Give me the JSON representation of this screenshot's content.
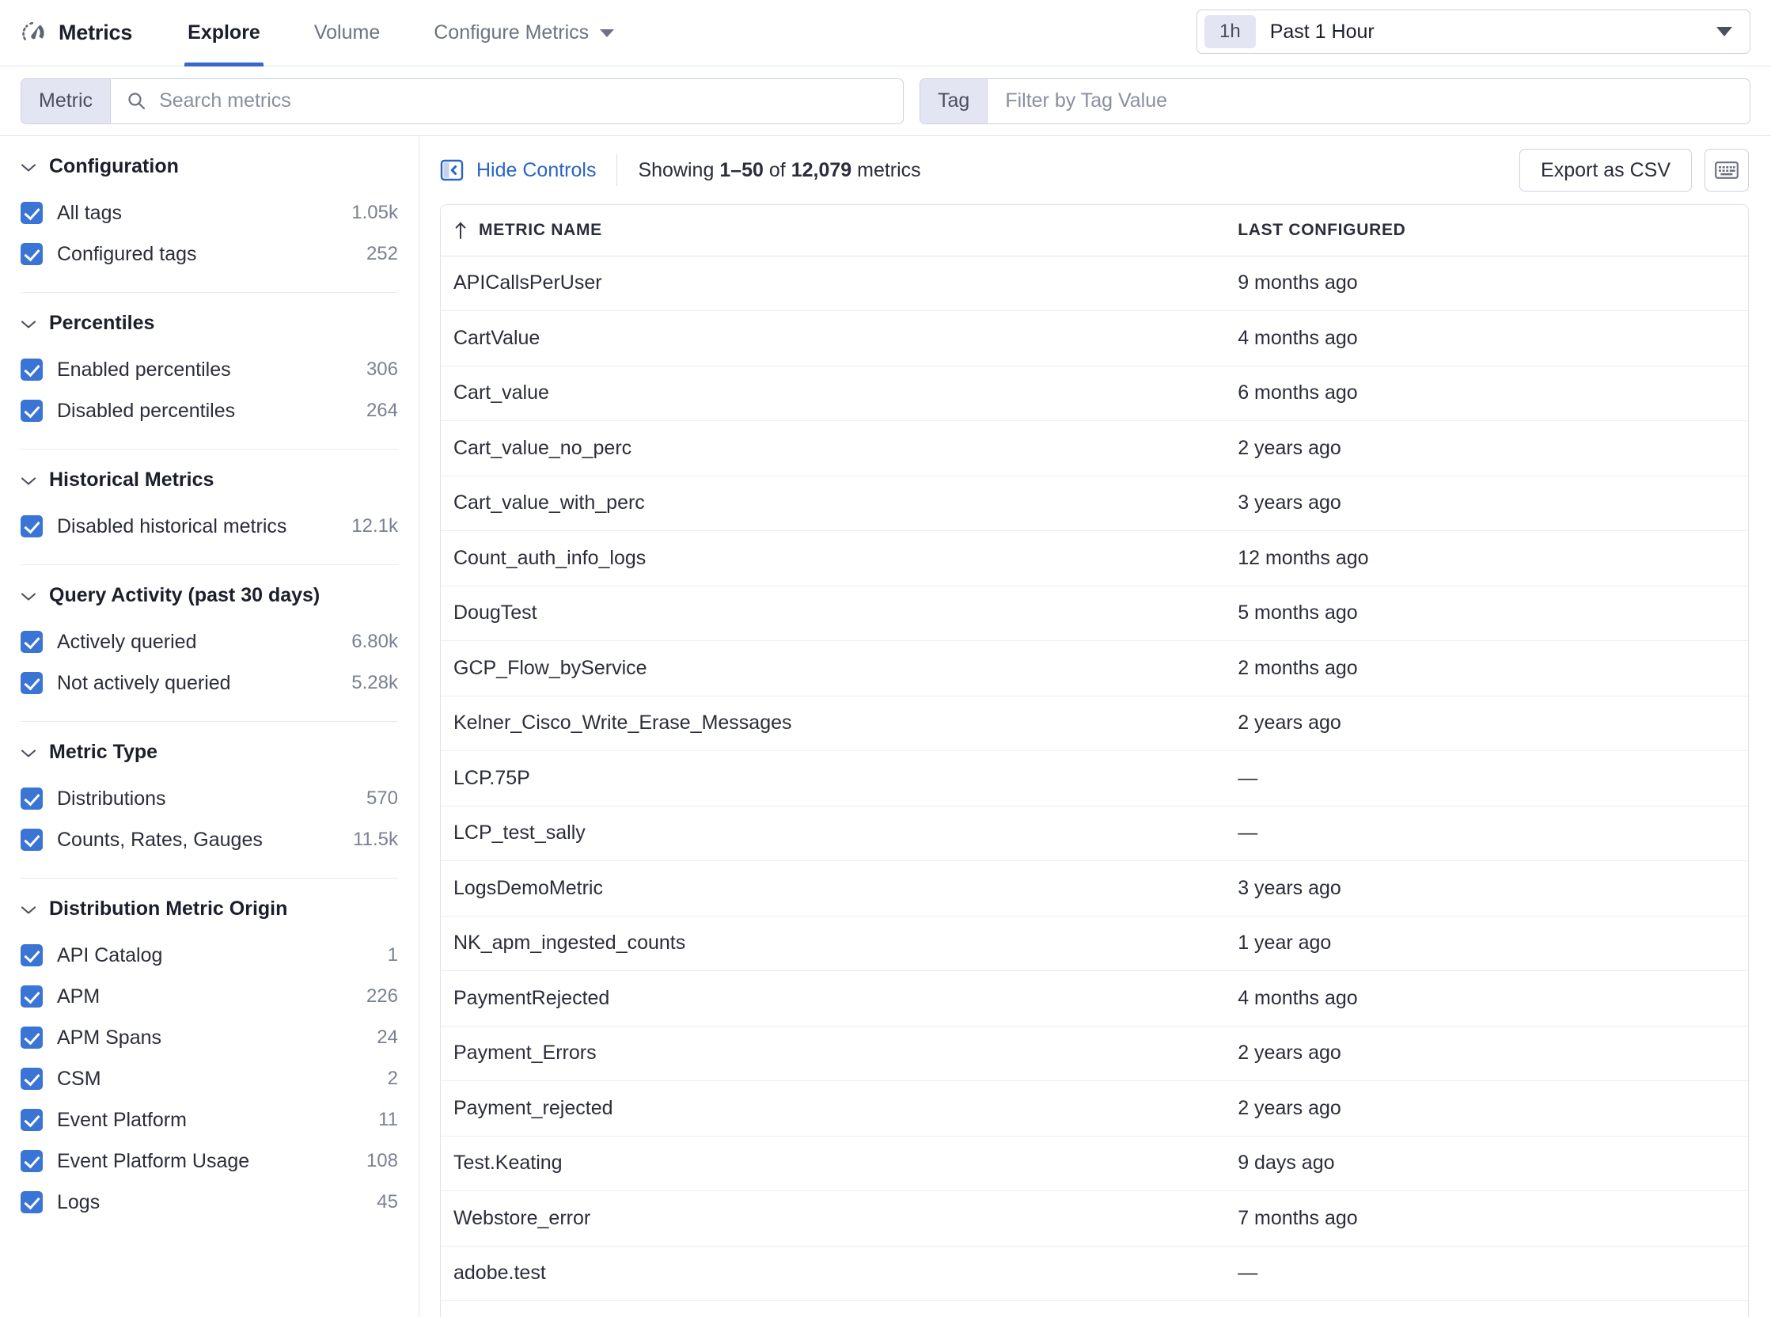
{
  "topnav": {
    "brand": "Metrics",
    "brand_icon": "gauge-icon",
    "tabs": [
      {
        "label": "Explore",
        "active": true,
        "has_caret": false
      },
      {
        "label": "Volume",
        "active": false,
        "has_caret": false
      },
      {
        "label": "Configure Metrics",
        "active": false,
        "has_caret": true
      }
    ],
    "timepicker": {
      "chip": "1h",
      "label": "Past 1 Hour"
    }
  },
  "search": {
    "metric": {
      "prefix": "Metric",
      "placeholder": "Search metrics",
      "value": ""
    },
    "tag": {
      "prefix": "Tag",
      "placeholder": "Filter by Tag Value",
      "value": ""
    }
  },
  "toolbar": {
    "hide_controls": "Hide Controls",
    "showing_prefix": "Showing",
    "showing_range": "1–50",
    "showing_of": "of",
    "showing_total": "12,079",
    "showing_suffix": "metrics",
    "export_csv": "Export as CSV",
    "keyboard_shortcut_icon": "keyboard-icon"
  },
  "sidebar": {
    "facets": [
      {
        "title": "Configuration",
        "items": [
          {
            "label": "All tags",
            "count": "1.05k",
            "checked": true
          },
          {
            "label": "Configured tags",
            "count": "252",
            "checked": true
          }
        ]
      },
      {
        "title": "Percentiles",
        "items": [
          {
            "label": "Enabled percentiles",
            "count": "306",
            "checked": true
          },
          {
            "label": "Disabled percentiles",
            "count": "264",
            "checked": true
          }
        ]
      },
      {
        "title": "Historical Metrics",
        "items": [
          {
            "label": "Disabled historical metrics",
            "count": "12.1k",
            "checked": true
          }
        ]
      },
      {
        "title": "Query Activity (past 30 days)",
        "items": [
          {
            "label": "Actively queried",
            "count": "6.80k",
            "checked": true
          },
          {
            "label": "Not actively queried",
            "count": "5.28k",
            "checked": true
          }
        ]
      },
      {
        "title": "Metric Type",
        "items": [
          {
            "label": "Distributions",
            "count": "570",
            "checked": true
          },
          {
            "label": "Counts, Rates, Gauges",
            "count": "11.5k",
            "checked": true
          }
        ]
      },
      {
        "title": "Distribution Metric Origin",
        "items": [
          {
            "label": "API Catalog",
            "count": "1",
            "checked": true
          },
          {
            "label": "APM",
            "count": "226",
            "checked": true
          },
          {
            "label": "APM Spans",
            "count": "24",
            "checked": true
          },
          {
            "label": "CSM",
            "count": "2",
            "checked": true
          },
          {
            "label": "Event Platform",
            "count": "11",
            "checked": true
          },
          {
            "label": "Event Platform Usage",
            "count": "108",
            "checked": true
          },
          {
            "label": "Logs",
            "count": "45",
            "checked": true
          }
        ]
      }
    ]
  },
  "table": {
    "columns": [
      {
        "label": "METRIC NAME",
        "sorted": "asc"
      },
      {
        "label": "LAST CONFIGURED",
        "sorted": null
      }
    ],
    "rows": [
      {
        "metric_name": "APICallsPerUser",
        "last_configured": "9 months ago"
      },
      {
        "metric_name": "CartValue",
        "last_configured": "4 months ago"
      },
      {
        "metric_name": "Cart_value",
        "last_configured": "6 months ago"
      },
      {
        "metric_name": "Cart_value_no_perc",
        "last_configured": "2 years ago"
      },
      {
        "metric_name": "Cart_value_with_perc",
        "last_configured": "3 years ago"
      },
      {
        "metric_name": "Count_auth_info_logs",
        "last_configured": "12 months ago"
      },
      {
        "metric_name": "DougTest",
        "last_configured": "5 months ago"
      },
      {
        "metric_name": "GCP_Flow_byService",
        "last_configured": "2 months ago"
      },
      {
        "metric_name": "Kelner_Cisco_Write_Erase_Messages",
        "last_configured": "2 years ago"
      },
      {
        "metric_name": "LCP.75P",
        "last_configured": "—"
      },
      {
        "metric_name": "LCP_test_sally",
        "last_configured": "—"
      },
      {
        "metric_name": "LogsDemoMetric",
        "last_configured": "3 years ago"
      },
      {
        "metric_name": "NK_apm_ingested_counts",
        "last_configured": "1 year ago"
      },
      {
        "metric_name": "PaymentRejected",
        "last_configured": "4 months ago"
      },
      {
        "metric_name": "Payment_Errors",
        "last_configured": "2 years ago"
      },
      {
        "metric_name": "Payment_rejected",
        "last_configured": "2 years ago"
      },
      {
        "metric_name": "Test.Keating",
        "last_configured": "9 days ago"
      },
      {
        "metric_name": "Webstore_error",
        "last_configured": "7 months ago"
      },
      {
        "metric_name": "adobe.test",
        "last_configured": "—"
      }
    ]
  },
  "colors": {
    "accent_blue": "#3766cc",
    "link_blue": "#2a64c4",
    "checkbox_blue": "#3a74d4",
    "text_primary": "#2b2d3a",
    "text_muted": "#7b8191",
    "border": "#e0e3ed"
  }
}
